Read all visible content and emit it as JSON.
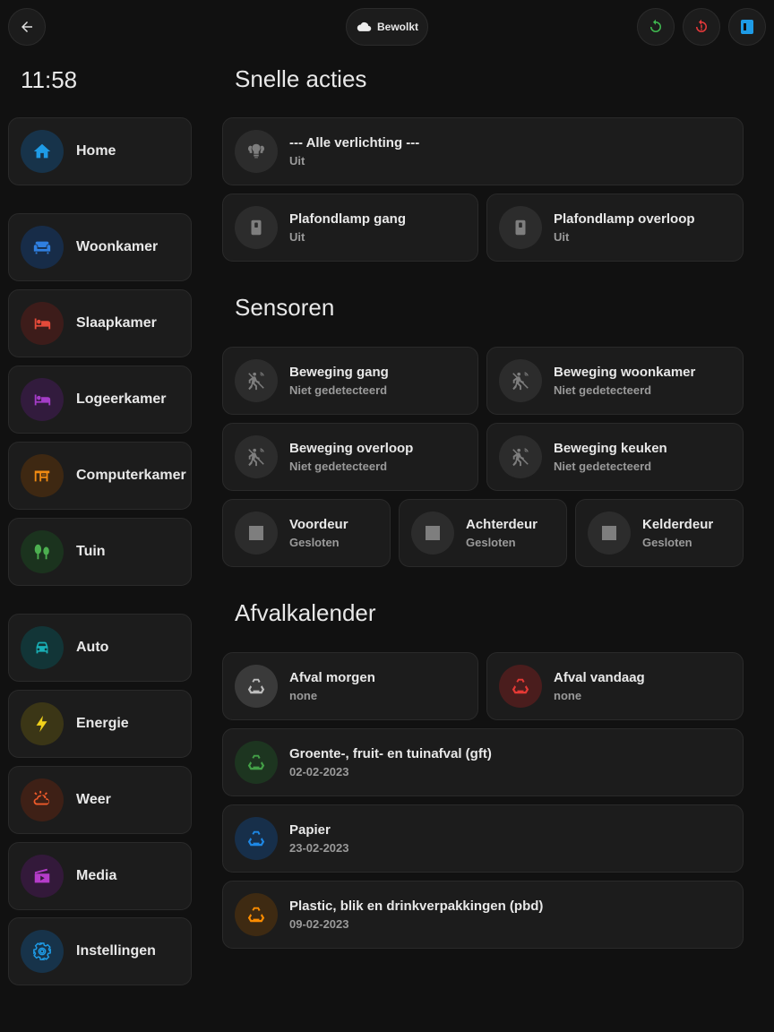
{
  "header": {
    "weather_label": "Bewolkt"
  },
  "clock": "11:58",
  "sidebar": {
    "items": [
      {
        "label": "Home",
        "icon": "home-icon",
        "color": "#1e9be6"
      },
      {
        "label": "Woonkamer",
        "icon": "sofa-icon",
        "color": "#2f7fe0"
      },
      {
        "label": "Slaapkamer",
        "icon": "bed-icon",
        "color": "#e44a3a"
      },
      {
        "label": "Logeerkamer",
        "icon": "bed-icon",
        "color": "#a43cc7"
      },
      {
        "label": "Computerkamer",
        "icon": "desk-icon",
        "color": "#f08a12"
      },
      {
        "label": "Tuin",
        "icon": "tree-icon",
        "color": "#4caf50"
      },
      {
        "label": "Auto",
        "icon": "car-icon",
        "color": "#19b0b6"
      },
      {
        "label": "Energie",
        "icon": "lightning-icon",
        "color": "#f2d21b"
      },
      {
        "label": "Weer",
        "icon": "weather-icon",
        "color": "#ef5a2a"
      },
      {
        "label": "Media",
        "icon": "media-icon",
        "color": "#b53cc9"
      },
      {
        "label": "Instellingen",
        "icon": "gear-icon",
        "color": "#1e9be6"
      }
    ]
  },
  "sections": {
    "quick_actions": "Snelle acties",
    "sensors": "Sensoren",
    "waste": "Afvalkalender"
  },
  "quick_actions": [
    {
      "name": "--- Alle verlichting ---",
      "state": "Uit"
    },
    {
      "name": "Plafondlamp gang",
      "state": "Uit"
    },
    {
      "name": "Plafondlamp overloop",
      "state": "Uit"
    }
  ],
  "sensors": [
    {
      "name": "Beweging gang",
      "state": "Niet gedetecteerd"
    },
    {
      "name": "Beweging woonkamer",
      "state": "Niet gedetecteerd"
    },
    {
      "name": "Beweging overloop",
      "state": "Niet gedetecteerd"
    },
    {
      "name": "Beweging keuken",
      "state": "Niet gedetecteerd"
    },
    {
      "name": "Voordeur",
      "state": "Gesloten"
    },
    {
      "name": "Achterdeur",
      "state": "Gesloten"
    },
    {
      "name": "Kelderdeur",
      "state": "Gesloten"
    }
  ],
  "waste": [
    {
      "name": "Afval morgen",
      "state": "none",
      "color": "#9e9e9e"
    },
    {
      "name": "Afval vandaag",
      "state": "none",
      "color": "#e53935"
    },
    {
      "name": "Groente-, fruit- en tuinafval (gft)",
      "state": "02-02-2023",
      "color": "#43a047"
    },
    {
      "name": "Papier",
      "state": "23-02-2023",
      "color": "#1e88e5"
    },
    {
      "name": "Plastic, blik en drinkverpakkingen (pbd)",
      "state": "09-02-2023",
      "color": "#fb8c00"
    }
  ],
  "colors": {
    "background": "#111111",
    "card": "#1c1c1c",
    "refresh": "#3fb950",
    "restart": "#e5393a",
    "blue_button": "#1e9be6"
  }
}
